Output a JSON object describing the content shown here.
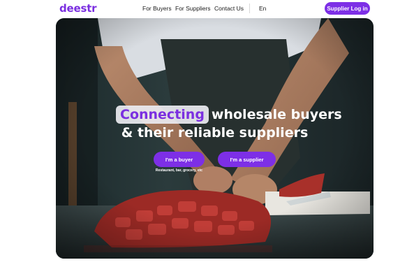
{
  "brand": {
    "logo_text": "deestr",
    "accent_color": "#7d2fe6"
  },
  "nav": {
    "for_buyers": "For Buyers",
    "for_suppliers": "For Suppliers",
    "contact_us": "Contact Us",
    "language": "En",
    "login_label": "Supplier Log in"
  },
  "hero": {
    "headline_highlight": "Connecting",
    "headline_rest": "wholesale buyers",
    "headline_line2": "& their reliable suppliers",
    "buyer_button": "I'm a buyer",
    "supplier_button": "I'm a supplier",
    "buyer_caption": "Restaurant, bar, grocery, etc"
  }
}
